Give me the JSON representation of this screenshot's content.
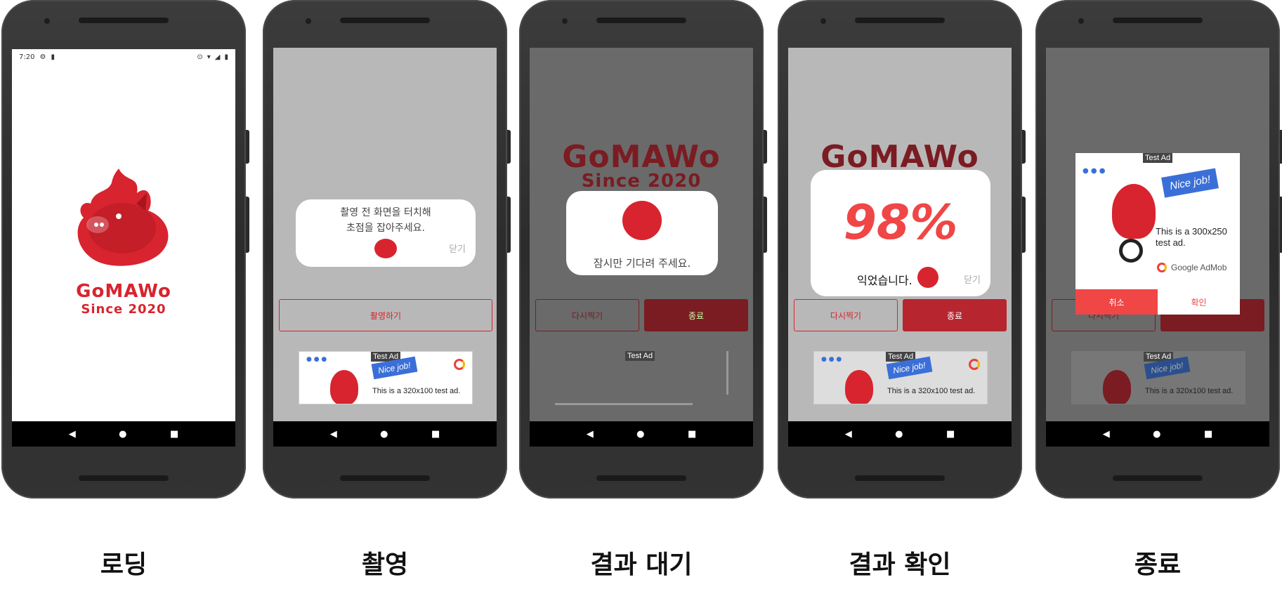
{
  "status": {
    "time": "7:20"
  },
  "nav": {
    "back": "◀",
    "home": "●",
    "recent": "■"
  },
  "logo": {
    "brand": "GoMAWo",
    "since": "Since 2020"
  },
  "captions": [
    "로딩",
    "촬영",
    "결과 대기",
    "결과 확인",
    "종료"
  ],
  "shoot": {
    "hint_line1": "촬영 전 화면을 터치해",
    "hint_line2": "초점을 잡아주세요.",
    "close": "닫기",
    "shoot_button": "촬영하기"
  },
  "wait": {
    "message": "잠시만 기다려 주세요.",
    "retake": "다시찍기",
    "exit": "종료"
  },
  "result": {
    "percent": "98%",
    "message": "익었습니다.",
    "close": "닫기",
    "retake": "다시찍기",
    "exit": "종료"
  },
  "exit_dialog": {
    "cancel": "취소",
    "confirm": "확인",
    "retake": "다시찍기",
    "exit": "종료"
  },
  "ad": {
    "tag": "Test Ad",
    "nice": "Nice job!",
    "banner_text": "This is a 320x100 test ad.",
    "interstitial_text_1": "This is a 300x250",
    "interstitial_text_2": "test ad.",
    "admob": "Google AdMob"
  },
  "colors": {
    "brand_red": "#d8242f",
    "dialog_red": "#f04646"
  }
}
